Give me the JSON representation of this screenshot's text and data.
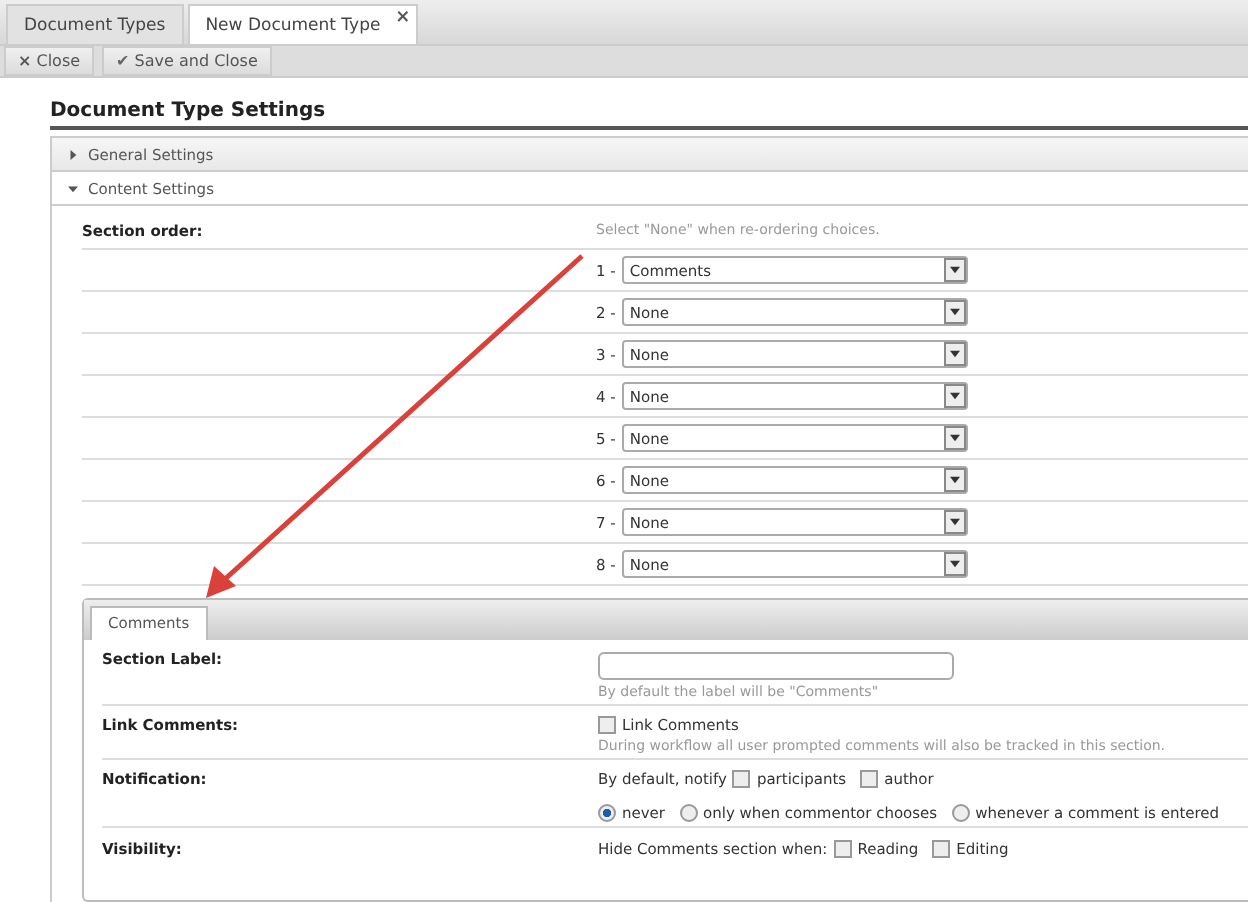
{
  "tabs": [
    {
      "label": "Document Types",
      "selected": false
    },
    {
      "label": "New Document Type",
      "selected": true,
      "close_glyph": "×"
    }
  ],
  "toolbar": [
    {
      "kind": "close",
      "icon": "×",
      "label": "Close"
    },
    {
      "kind": "save",
      "icon": "✔",
      "label": "Save and Close"
    }
  ],
  "title": "Document Type Settings",
  "sections": [
    {
      "label": "General Settings",
      "expanded": false
    },
    {
      "label": "Content Settings",
      "expanded": true
    }
  ],
  "section_order": {
    "label": "Section order:",
    "hint": "Select \"None\" when re-ordering choices.",
    "slots": [
      {
        "number": "1 -",
        "value": "Comments"
      },
      {
        "number": "2 -",
        "value": "None"
      },
      {
        "number": "3 -",
        "value": "None"
      },
      {
        "number": "4 -",
        "value": "None"
      },
      {
        "number": "5 -",
        "value": "None"
      },
      {
        "number": "6 -",
        "value": "None"
      },
      {
        "number": "7 -",
        "value": "None"
      },
      {
        "number": "8 -",
        "value": "None"
      }
    ]
  },
  "subpanel": {
    "tab": "Comments",
    "section_label": {
      "label": "Section Label:",
      "hint": "By default the label will be \"Comments\""
    },
    "link_comments": {
      "label": "Link Comments:",
      "option": "Link Comments",
      "checked": false,
      "hint": "During workflow all user prompted comments will also be tracked in this section."
    },
    "notification": {
      "label": "Notification:",
      "prefix": "By default, notify",
      "checks": [
        {
          "label": "participants",
          "checked": false
        },
        {
          "label": "author",
          "checked": false
        }
      ],
      "radios": [
        {
          "label": "never",
          "selected": true
        },
        {
          "label": "only when commentor chooses",
          "selected": false
        },
        {
          "label": "whenever a comment is entered",
          "selected": false
        }
      ]
    },
    "visibility": {
      "label": "Visibility:",
      "prefix": "Hide Comments section when:",
      "checks": [
        {
          "label": "Reading",
          "checked": false
        },
        {
          "label": "Editing",
          "checked": false
        }
      ]
    }
  }
}
